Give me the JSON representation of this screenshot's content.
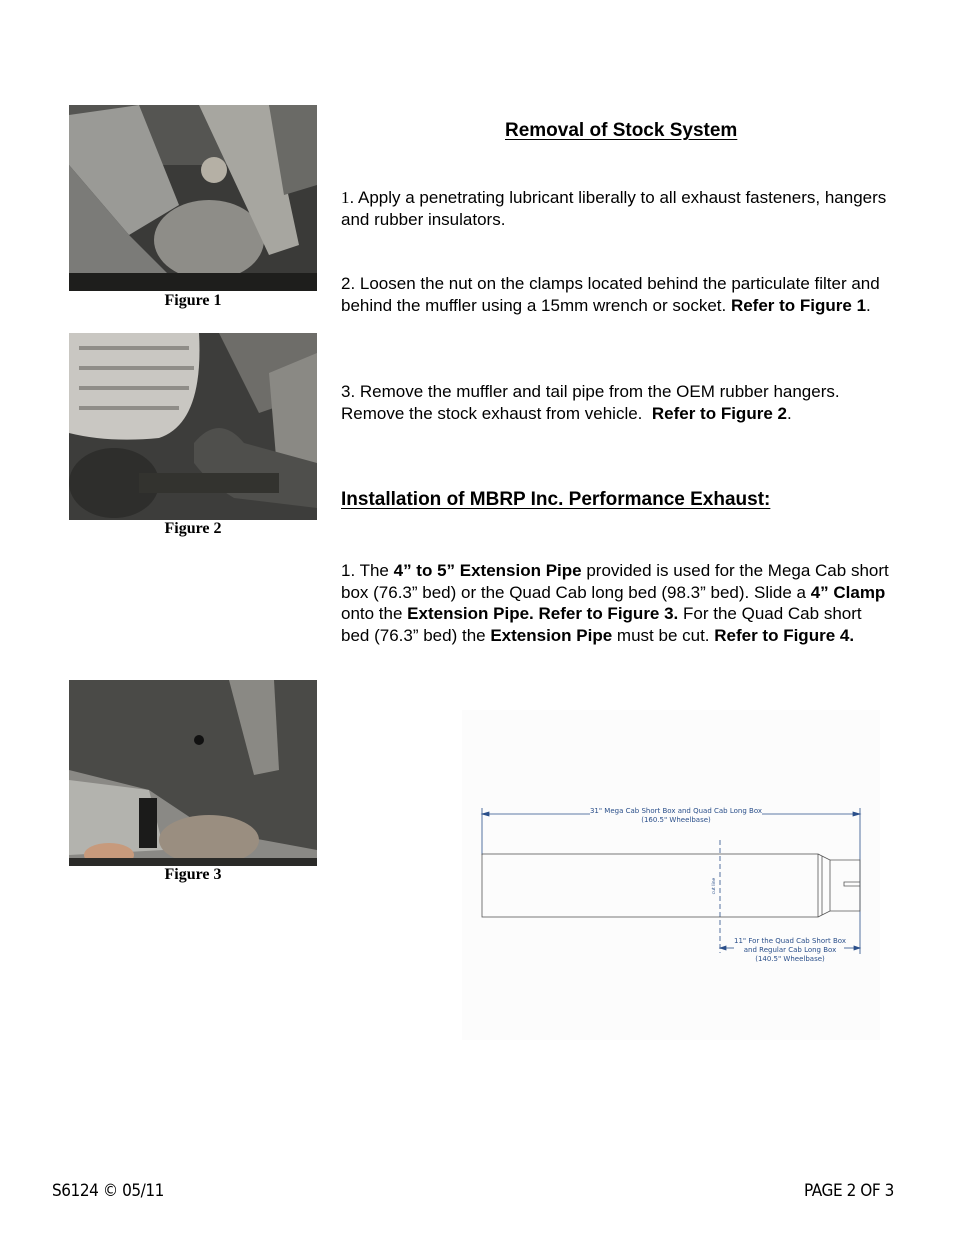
{
  "figures": [
    {
      "caption": "Figure 1",
      "description": "Underside of truck showing exhaust pipe, clamp and particulate filter"
    },
    {
      "caption": "Figure 2",
      "description": "Tail pipe routed over rear axle near tire"
    },
    {
      "caption": "Figure 3",
      "description": "Clamp being slid onto extension pipe under frame"
    }
  ],
  "removal": {
    "heading": "Removal of Stock System",
    "steps": [
      {
        "num": "1",
        "text": ". Apply a penetrating lubricant liberally to all exhaust fasteners, hangers and rubber insulators."
      },
      {
        "text": "2. Loosen the nut on the clamps located behind the particulate filter and behind the muffler using a 15mm wrench or socket.",
        "ref": "Refer to Figure 1",
        "ref_end": "."
      },
      {
        "text": "3. Remove the muffler and tail pipe from the OEM rubber hangers. Remove the stock exhaust from vehicle.",
        "ref": "Refer to Figure 2",
        "ref_end": "."
      }
    ]
  },
  "installation": {
    "heading": "Installation of MBRP Inc. Performance Exhaust:",
    "step1": {
      "t1": "1. The ",
      "b1": "4” to 5” Extension Pipe",
      "t2": " provided is used for the Mega Cab short box (76.3” bed) or the Quad Cab long bed (98.3” bed). Slide a ",
      "b2": "4” Clamp",
      "t3": " onto the ",
      "b3": "Extension Pipe.  Refer to Figure 3.",
      "t4": " For the Quad Cab short bed (76.3” bed) the ",
      "b4": "Extension Pipe",
      "t5": " must be cut.  ",
      "b5": "Refer to Figure 4."
    }
  },
  "diagram": {
    "top_dim_line1": "31\" Mega Cab Short Box and Quad Cab Long Box",
    "top_dim_line2": "(160.5\" Wheelbase)",
    "cut_label": "cut line",
    "bottom_dim_line1": "11\" For the Quad Cab Short Box",
    "bottom_dim_line2": "and Regular Cab Long Box",
    "bottom_dim_line3": "(140.5\" Wheelbase)",
    "line_color": "#2a4f8a"
  },
  "footer": {
    "doc_id": "S6124 © 05/11",
    "page": "PAGE 2 OF 3"
  }
}
